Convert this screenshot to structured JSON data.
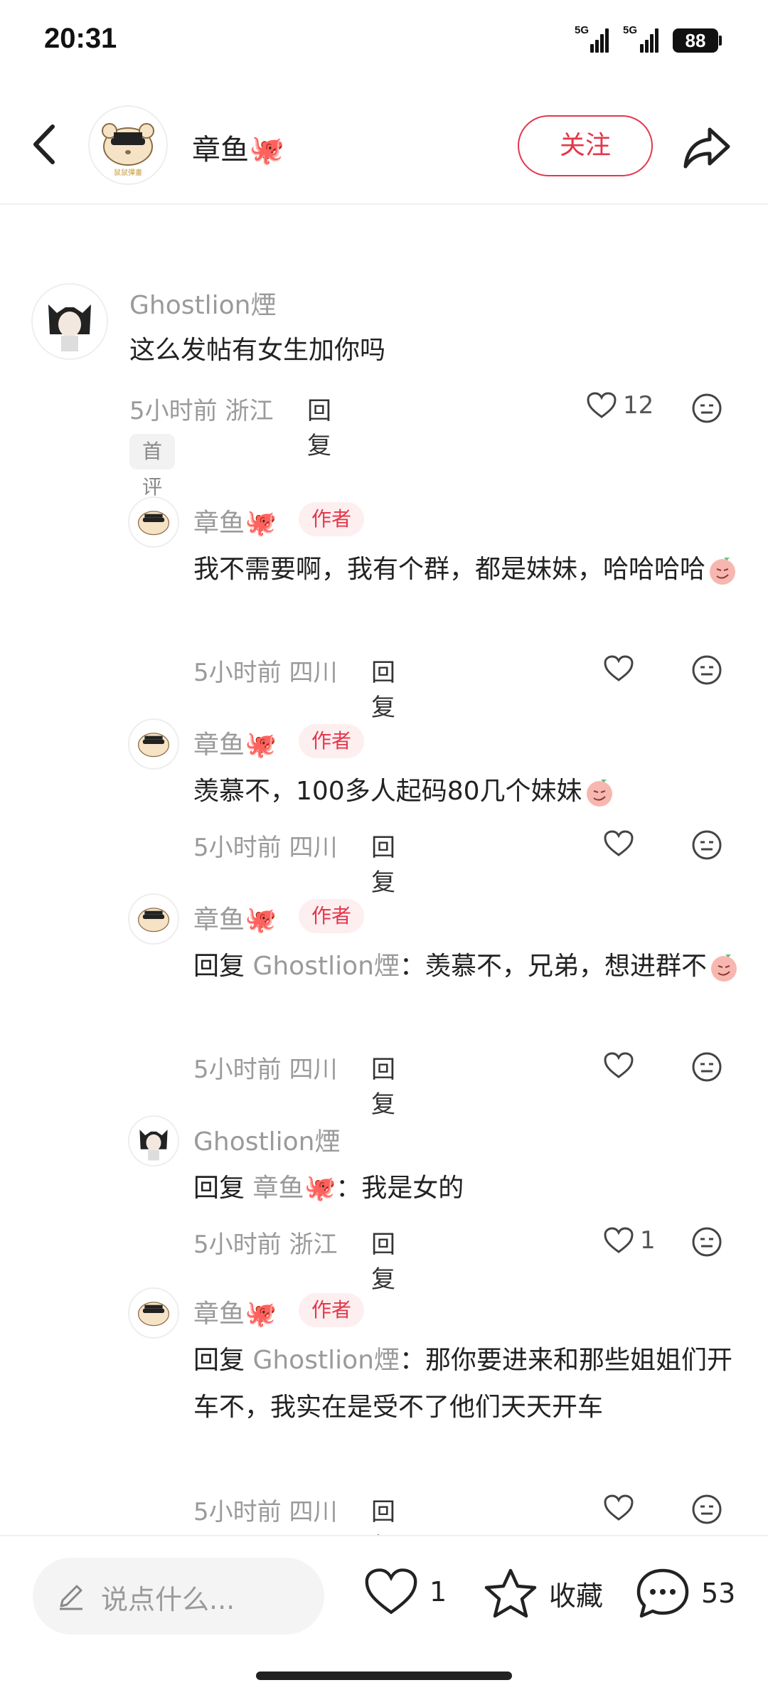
{
  "status": {
    "time": "20:31",
    "signal1": "5G",
    "signal2": "5G",
    "battery": "88"
  },
  "header": {
    "title": "章鱼🐙",
    "follow_label": "关注"
  },
  "comments": [
    {
      "user": "Ghostlion煙",
      "text": "这么发帖有女生加你吗",
      "time": "5小时前",
      "location": "浙江",
      "reply_label": "回复",
      "likes": "12",
      "tag": "首评"
    },
    {
      "user": "章鱼🐙",
      "author_tag": "作者",
      "text": "我不需要啊，我有个群，都是妹妹，哈哈哈哈",
      "time": "5小时前",
      "location": "四川",
      "reply_label": "回复",
      "likes": ""
    },
    {
      "user": "章鱼🐙",
      "author_tag": "作者",
      "text": "羡慕不，100多人起码80几个妹妹",
      "time": "5小时前",
      "location": "四川",
      "reply_label": "回复",
      "likes": ""
    },
    {
      "user": "章鱼🐙",
      "author_tag": "作者",
      "reply_prefix": "回复",
      "reply_to": "Ghostlion煙",
      "text": "：羡慕不，兄弟，想进群不",
      "time": "5小时前",
      "location": "四川",
      "reply_label": "回复",
      "likes": ""
    },
    {
      "user": "Ghostlion煙",
      "reply_prefix": "回复",
      "reply_to": "章鱼🐙",
      "text": "：我是女的",
      "time": "5小时前",
      "location": "浙江",
      "reply_label": "回复",
      "likes": "1"
    },
    {
      "user": "章鱼🐙",
      "author_tag": "作者",
      "reply_prefix": "回复",
      "reply_to": "Ghostlion煙",
      "text": "：那你要进来和那些姐姐们开车不，我实在是受不了他们天天开车",
      "time": "5小时前",
      "location": "四川",
      "reply_label": "回复",
      "likes": ""
    }
  ],
  "bottom": {
    "placeholder": "说点什么...",
    "likes": "1",
    "collect_label": "收藏",
    "comments": "53"
  },
  "colors": {
    "accent": "#e3374a",
    "muted": "#9a9a9a"
  }
}
